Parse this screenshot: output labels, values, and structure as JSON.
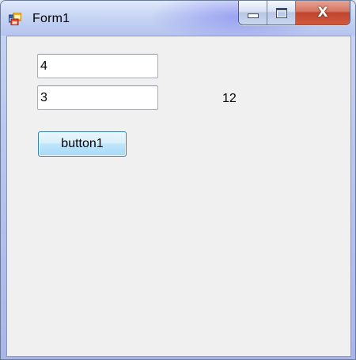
{
  "window": {
    "title": "Form1",
    "icon": "winforms-app-icon",
    "controls": {
      "minimize_icon": "minimize-icon",
      "maximize_icon": "maximize-icon",
      "close_icon": "close-icon",
      "close_glyph": "X"
    }
  },
  "form": {
    "textbox1_value": "4",
    "textbox2_value": "3",
    "result_label": "12",
    "button1_label": "button1"
  }
}
